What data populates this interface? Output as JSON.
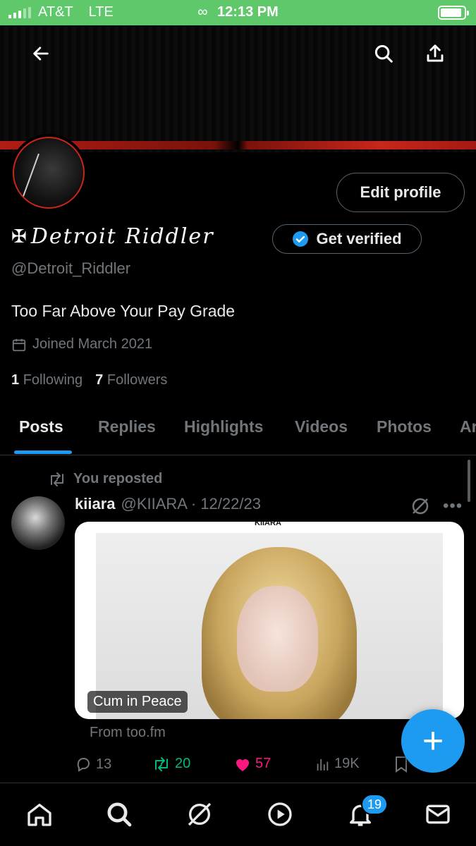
{
  "status_bar": {
    "carrier": "AT&T",
    "network": "LTE",
    "time": "12:13 PM",
    "battery_level": 0.9
  },
  "profile": {
    "display_name": "Detroit Riddler",
    "handle": "@Detroit_Riddler",
    "bio": "Too Far Above Your Pay Grade",
    "joined": "Joined March 2021",
    "following_count": "1",
    "following_label": "Following",
    "followers_count": "7",
    "followers_label": "Followers",
    "edit_profile_label": "Edit profile",
    "get_verified_label": "Get verified"
  },
  "tabs": [
    {
      "label": "Posts"
    },
    {
      "label": "Replies"
    },
    {
      "label": "Highlights"
    },
    {
      "label": "Videos"
    },
    {
      "label": "Photos"
    },
    {
      "label": "Ar"
    }
  ],
  "post": {
    "repost_label": "You reposted",
    "author": "kiiara",
    "handle_date": "@KIIARA · 12/22/23",
    "card_label": "Cum in Peace",
    "card_source": "From too.fm",
    "card_logo": "KIIARA",
    "replies": "13",
    "reposts": "20",
    "likes": "57",
    "views": "19K"
  },
  "notifications_badge": "19",
  "colors": {
    "accent": "#1d9bf0",
    "repost": "#00ba7c",
    "like": "#f91880",
    "status_bar": "#5fc86a"
  }
}
